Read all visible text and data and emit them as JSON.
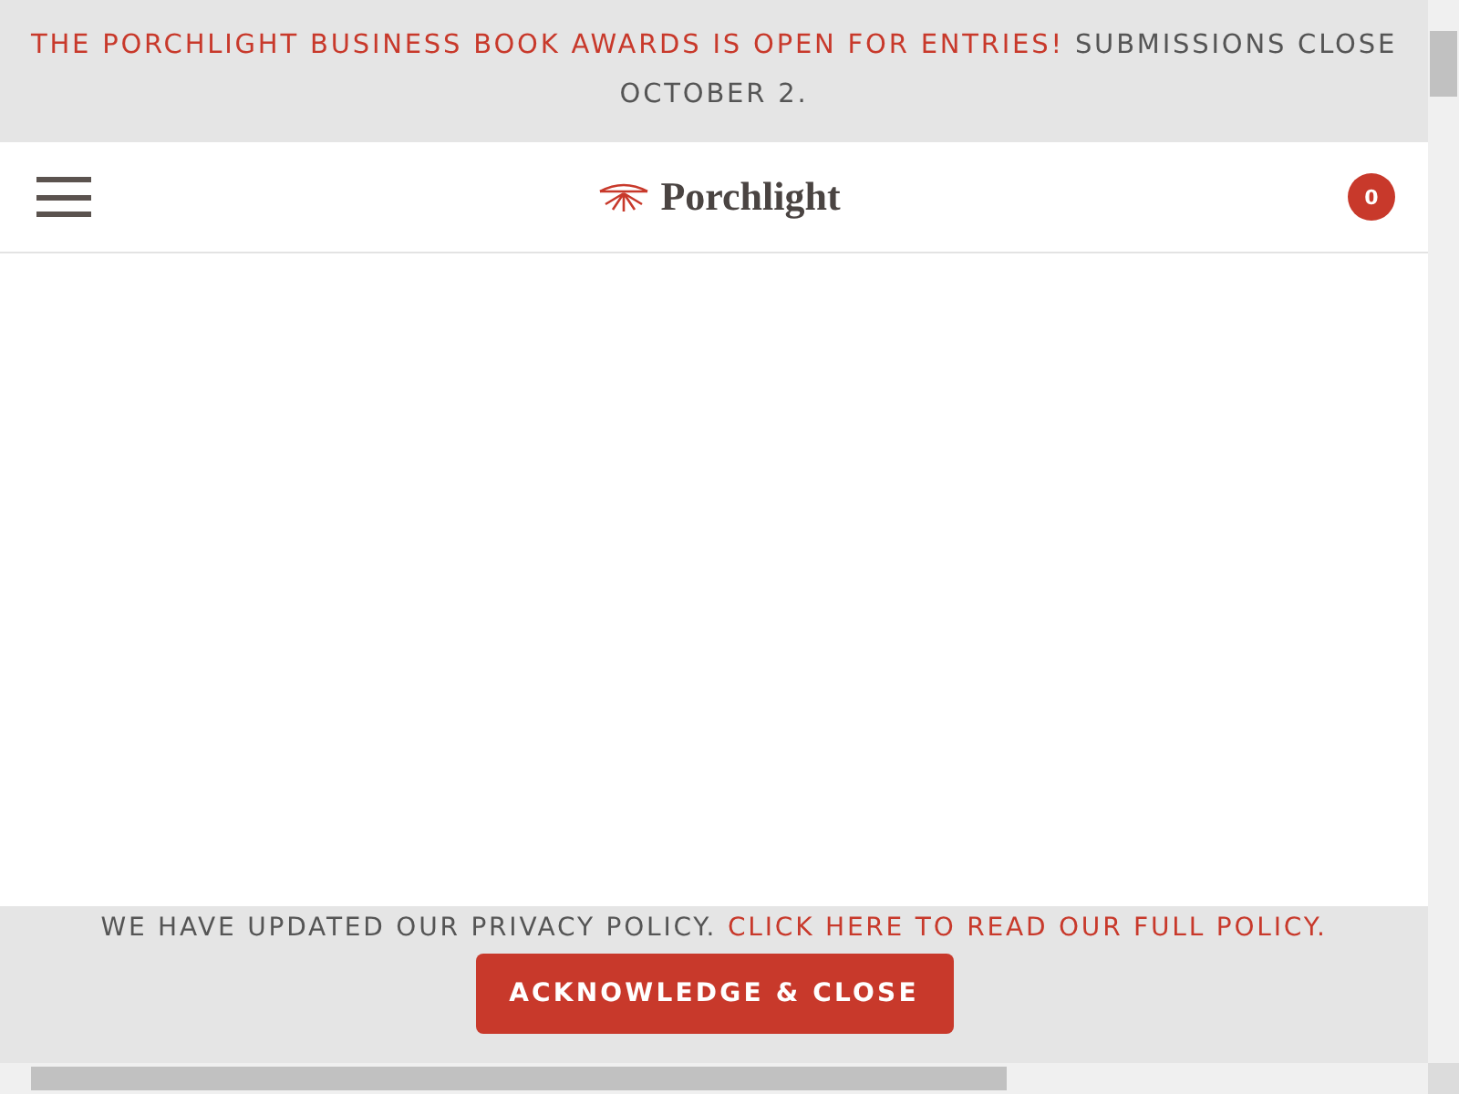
{
  "announcement": {
    "link": "THE PORCHLIGHT BUSINESS BOOK AWARDS IS OPEN FOR ENTRIES!",
    "text": "SUBMISSIONS CLOSE OCTOBER 2."
  },
  "header": {
    "logo": "Porchlight",
    "cart_count": "0"
  },
  "privacy_bar": {
    "text": "WE HAVE UPDATED OUR PRIVACY POLICY.",
    "link": "CLICK HERE TO READ OUR FULL POLICY.",
    "button": "ACKNOWLEDGE & CLOSE"
  }
}
